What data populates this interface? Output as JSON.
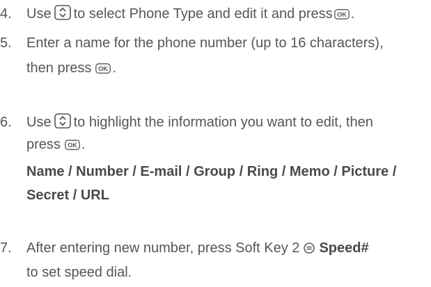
{
  "steps": {
    "s4": {
      "num": "4.",
      "t1": "Use",
      "t2": "to select Phone Type and edit it and press",
      "t3": "."
    },
    "s5": {
      "num": "5.",
      "line1": "Enter a name for the phone number (up to 16 characters),",
      "t2": "then press",
      "t3": "."
    },
    "s6": {
      "num": "6.",
      "t1": "Use",
      "t2": "to highlight the information you want to edit, then",
      "t3": "press",
      "t4": ".",
      "options": {
        "name": "Name",
        "number": "Number",
        "email": "E-mail",
        "group": "Group",
        "ring": "Ring",
        "memo": "Memo",
        "picture": "Picture",
        "secret": "Secret",
        "url": "URL",
        "sep": " / "
      }
    },
    "s7": {
      "num": "7.",
      "t1": "After entering new number,  press Soft Key 2",
      "t2": "Speed#",
      "line2": "to set speed dial."
    }
  },
  "icons": {
    "nav_key": "navigation-key-icon",
    "ok_key": "ok-key-icon",
    "soft_key": "soft-key-icon",
    "ok_label": "OK"
  },
  "colors": {
    "text": "#555555",
    "icon_stroke": "#555555"
  }
}
